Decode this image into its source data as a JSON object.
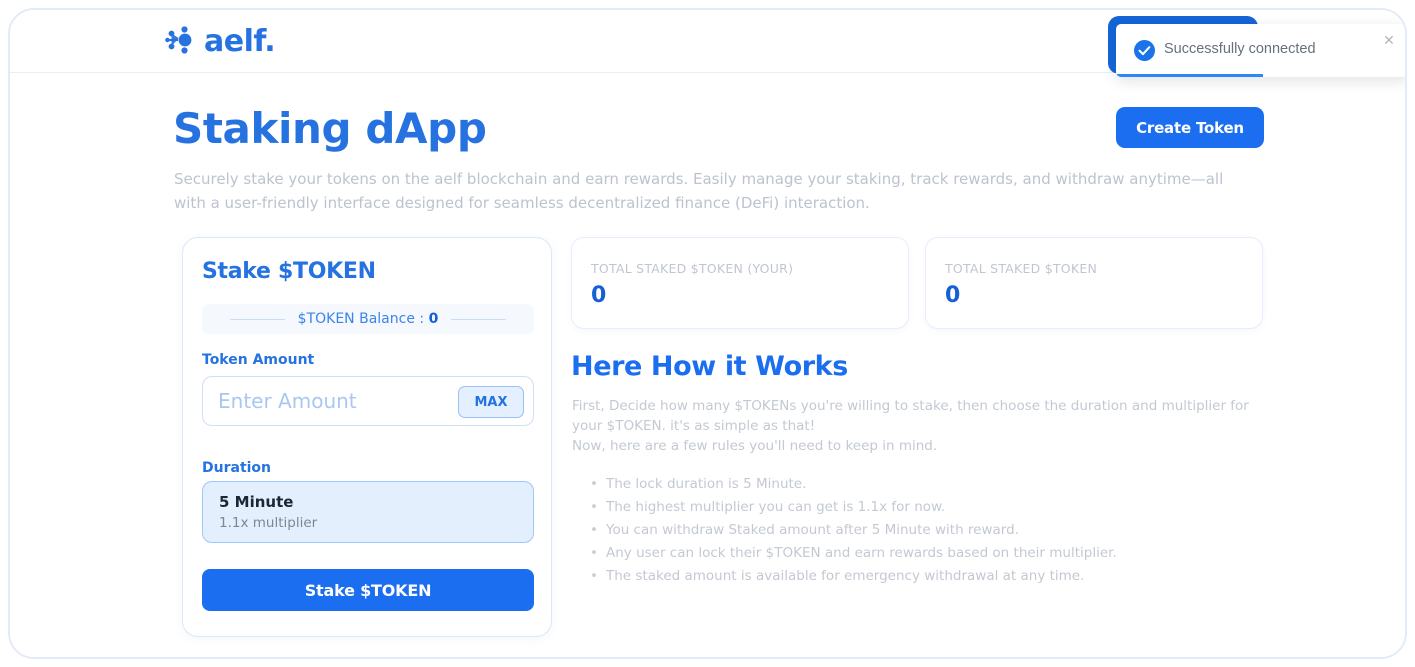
{
  "header": {
    "brand_wordmark": "aelf.",
    "logo_icon": "aelf-network-dots-icon",
    "connect_button_label": ""
  },
  "toast": {
    "message": "Successfully connected",
    "check_icon": "check-circle-icon",
    "close_icon": "close-icon",
    "progress_percent": 50,
    "accent_color": "#2f87f5"
  },
  "page": {
    "title": "Staking dApp",
    "subtitle": "Securely stake your tokens on the aelf blockchain and earn rewards. Easily manage your staking, track rewards, and withdraw anytime—all with a user-friendly interface designed for seamless decentralized finance (DeFi) interaction.",
    "create_token_label": "Create Token"
  },
  "stake_card": {
    "title": "Stake $TOKEN",
    "balance_label": "$TOKEN Balance : ",
    "balance_value": "0",
    "token_amount_label": "Token Amount",
    "token_amount_value": "",
    "token_amount_placeholder": "Enter Amount",
    "max_label": "MAX",
    "duration_label": "Duration",
    "duration_option_title": "5 Minute",
    "duration_option_subtitle": "1.1x multiplier",
    "submit_label": "Stake $TOKEN"
  },
  "stats": [
    {
      "label": "TOTAL STAKED $TOKEN (YOUR)",
      "value": "0"
    },
    {
      "label": "TOTAL STAKED $TOKEN",
      "value": "0"
    }
  ],
  "how_it_works": {
    "title": "Here How it Works",
    "paragraph": "First, Decide how many $TOKENs you're willing to stake, then choose the duration and multiplier for your $TOKEN. it's as simple as that!\nNow, here are a few rules you'll need to keep in mind.",
    "rules": [
      "The lock duration is 5 Minute.",
      "The highest multiplier you can get is 1.1x for now.",
      "You can withdraw Staked amount after 5 Minute with reward.",
      "Any user can lock their $TOKEN and earn rewards based on their multiplier.",
      "The staked amount is available for emergency withdrawal at any time."
    ]
  },
  "colors": {
    "brand_blue": "#2572e0",
    "button_blue": "#1b6ef0",
    "muted_text": "#c3c9d3"
  }
}
